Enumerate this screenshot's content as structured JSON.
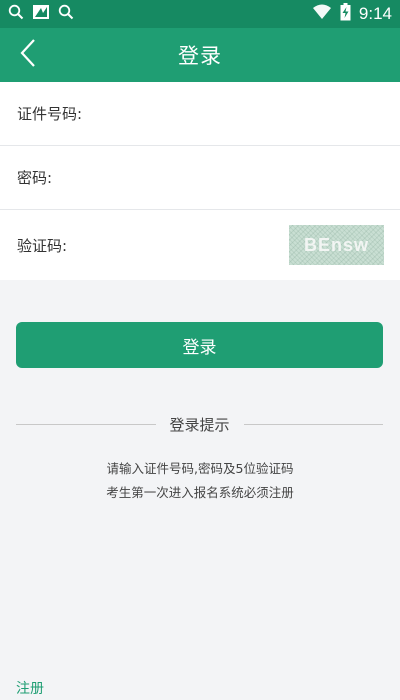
{
  "status_bar": {
    "time": "9:14",
    "icons": [
      "search-icon",
      "app-notification-icon",
      "search-icon",
      "wifi-icon",
      "battery-charging-icon"
    ]
  },
  "app_bar": {
    "title": "登录",
    "back_icon": "back-chevron-icon"
  },
  "form": {
    "id_label": "证件号码:",
    "id_value": "",
    "password_label": "密码:",
    "password_value": "",
    "captcha_label": "验证码:",
    "captcha_value": "",
    "captcha_image_text": "BEnsw"
  },
  "login_button": "登录",
  "tips": {
    "title": "登录提示",
    "line1": "请输入证件号码,密码及5位验证码",
    "line2": "考生第一次进入报名系统必须注册"
  },
  "register_link": "注册",
  "colors": {
    "status_bar": "#168a62",
    "primary": "#1f9e73",
    "background": "#f3f4f6",
    "captcha_bg": "#c9dfd3"
  }
}
